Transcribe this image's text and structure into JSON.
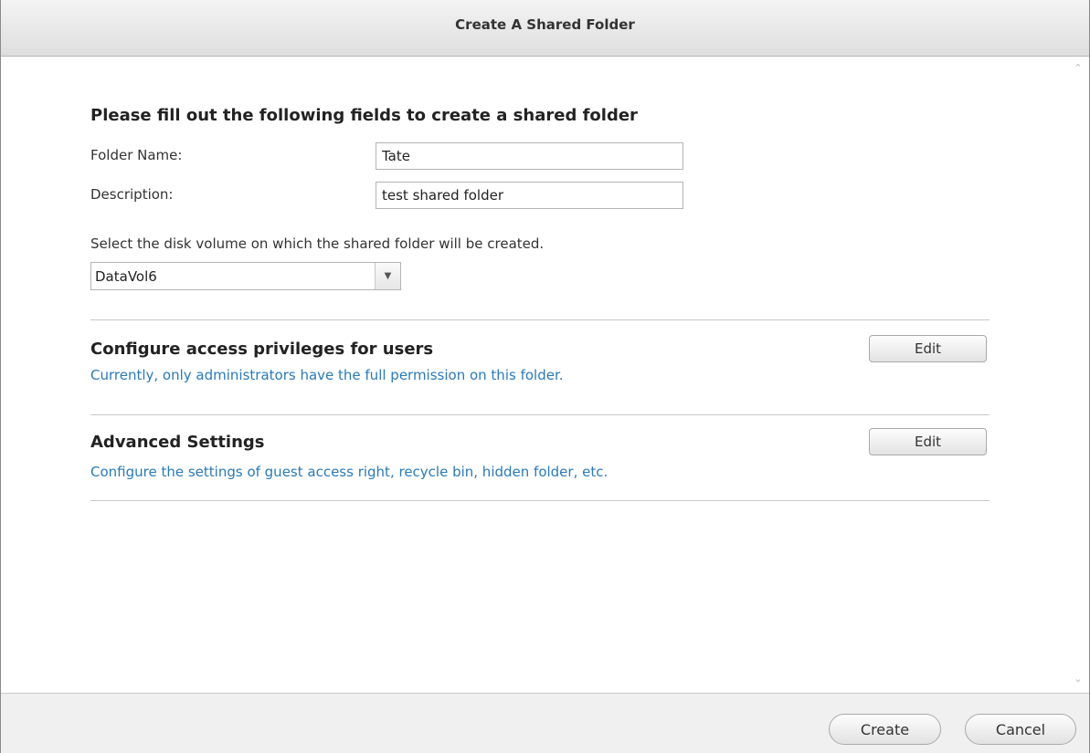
{
  "window": {
    "title": "Create A Shared Folder"
  },
  "form": {
    "heading": "Please fill out the following fields to create a shared folder",
    "folder_name_label": "Folder Name:",
    "folder_name_value": "Tate",
    "description_label": "Description:",
    "description_value": "test shared folder",
    "volume_hint": "Select the disk volume on which the shared folder will be created.",
    "volume_selected": "DataVol6"
  },
  "sections": [
    {
      "title": "Configure access privileges for users",
      "description": "Currently, only administrators have the full permission on this folder.",
      "button_label": "Edit"
    },
    {
      "title": "Advanced Settings",
      "description": "Configure the settings of guest access right, recycle bin, hidden folder, etc.",
      "button_label": "Edit"
    }
  ],
  "footer": {
    "create_label": "Create",
    "cancel_label": "Cancel"
  },
  "icons": {
    "dropdown": "chevron-down-icon",
    "scroll_up": "scroll-up-icon",
    "scroll_down": "scroll-down-icon"
  },
  "colors": {
    "link_text": "#2a7ab8",
    "titlebar": "#e6e6e6",
    "footer": "#f0f0f0"
  }
}
